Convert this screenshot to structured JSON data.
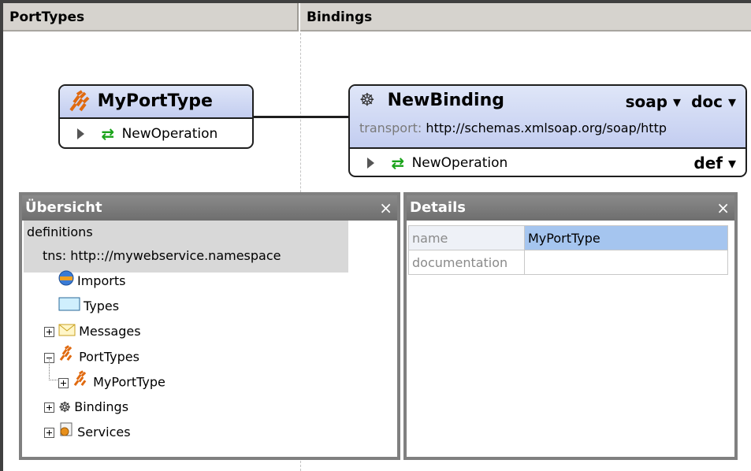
{
  "columns": {
    "porttypes": "PortTypes",
    "bindings": "Bindings"
  },
  "porttype_box": {
    "title": "MyPortType",
    "operation": "NewOperation"
  },
  "binding_box": {
    "title": "NewBinding",
    "soap_select": "soap",
    "doc_select": "doc",
    "transport_label": "transport:",
    "transport_value": "http://schemas.xmlsoap.org/soap/http",
    "operation": "NewOperation",
    "def_select": "def"
  },
  "overview": {
    "title": "Übersicht",
    "close": "×",
    "root": "definitions",
    "tns": "tns:  http:://mywebservice.namespace",
    "items": {
      "imports": "Imports",
      "types": "Types",
      "messages": "Messages",
      "porttypes": "PortTypes",
      "myporttype": "MyPortType",
      "bindings": "Bindings",
      "services": "Services"
    }
  },
  "details": {
    "title": "Details",
    "close": "×",
    "rows": [
      {
        "key": "name",
        "value": "MyPortType"
      },
      {
        "key": "documentation",
        "value": ""
      }
    ]
  },
  "colors": {
    "selection": "#a5c5ef",
    "tree_highlight": "#d8d8d8",
    "header_gradient": "#c3cdf0"
  }
}
